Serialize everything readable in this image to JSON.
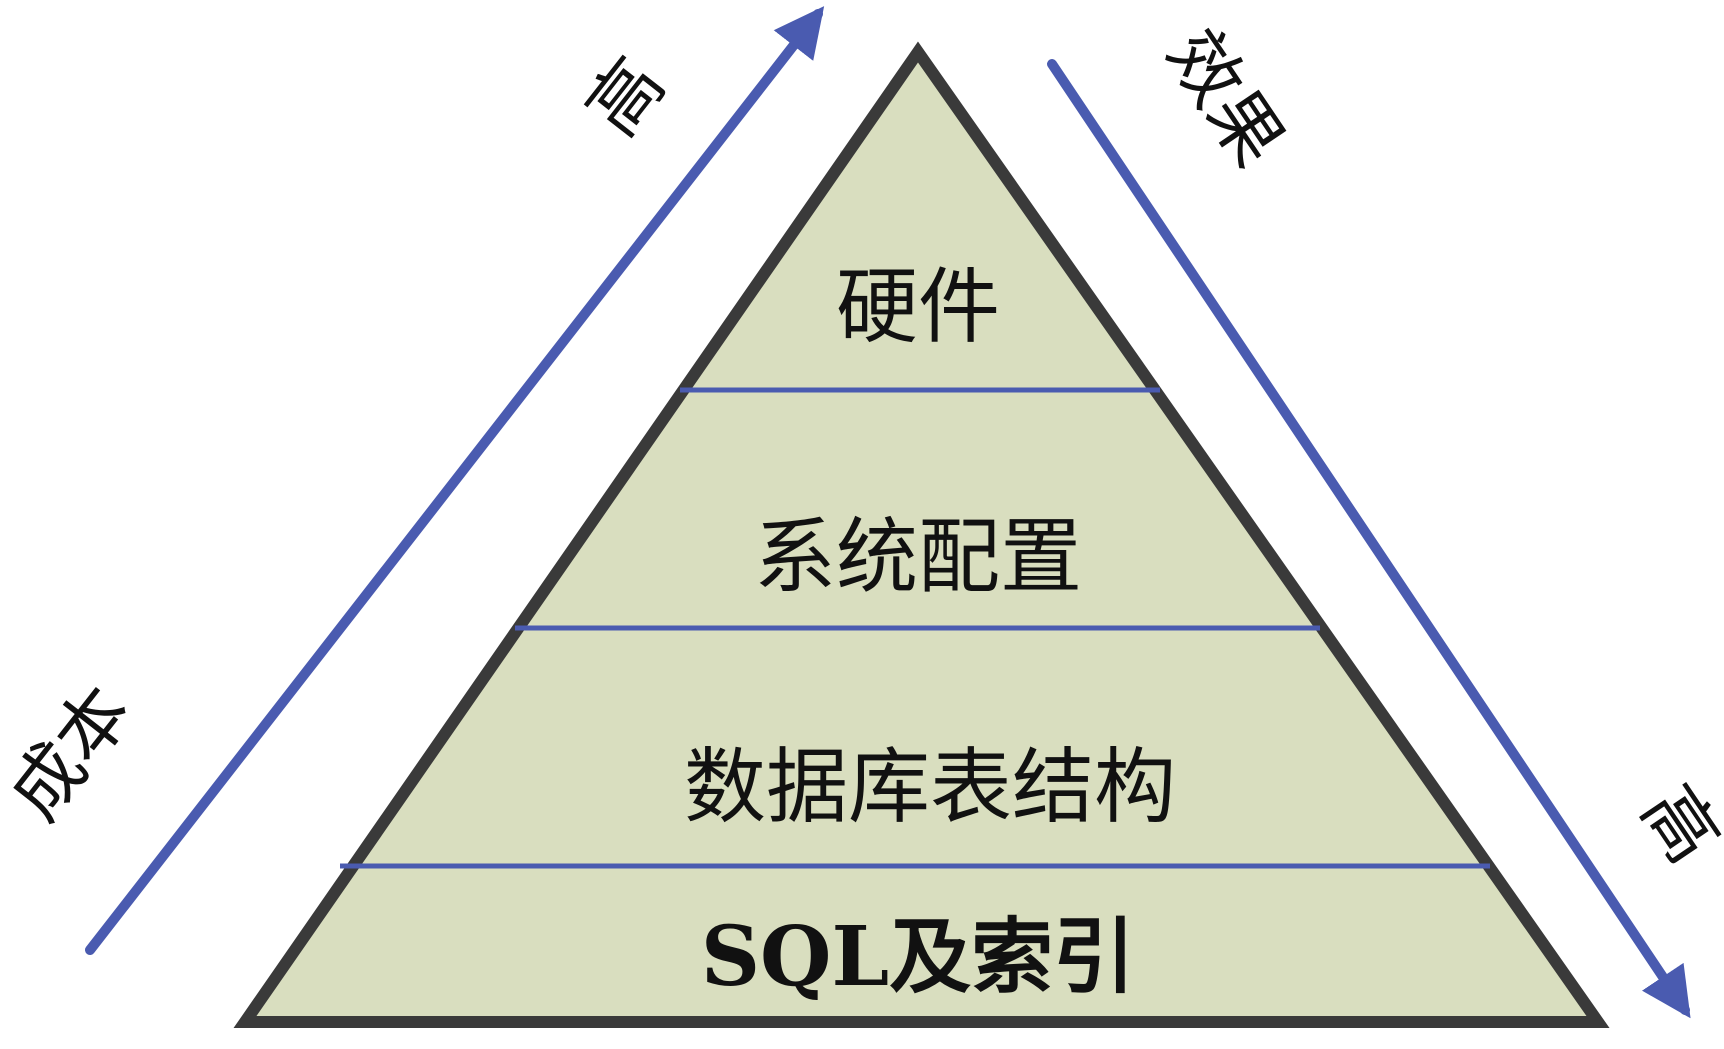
{
  "diagram": {
    "layers": [
      {
        "label": "硬件"
      },
      {
        "label": "系统配置"
      },
      {
        "label": "数据库表结构"
      },
      {
        "label": "SQL及索引"
      }
    ],
    "left_axis": {
      "label": "成本",
      "high_label": "高"
    },
    "right_axis": {
      "label": "效果",
      "high_label": "高"
    }
  },
  "colors": {
    "fill": "#D9DEBF",
    "outline": "#3a3a3a",
    "divider": "#4A5BB0",
    "arrow": "#4A5BB0"
  }
}
